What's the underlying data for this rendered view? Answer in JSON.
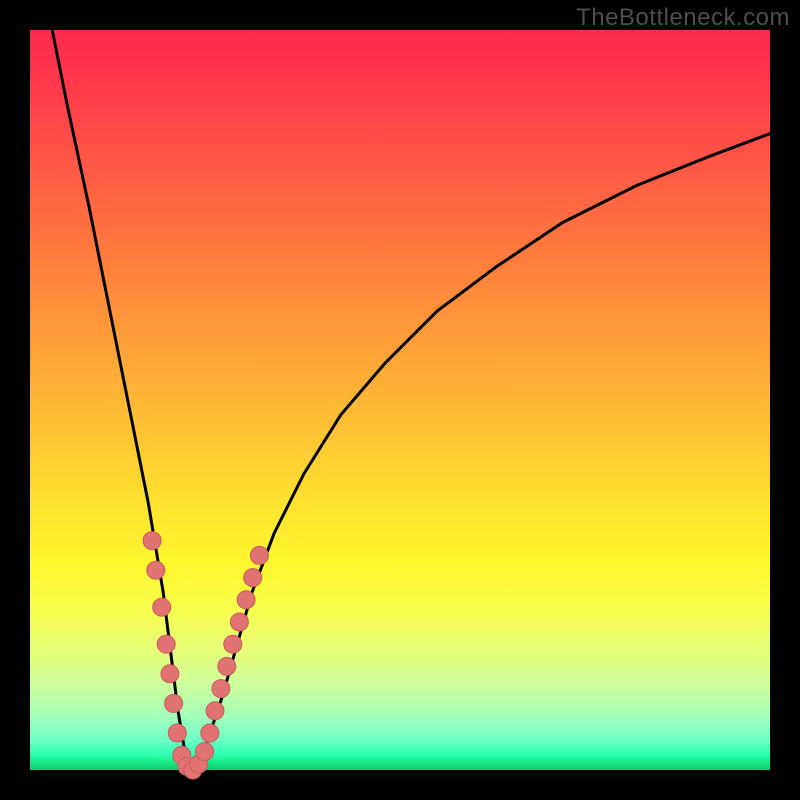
{
  "watermark": "TheBottleneck.com",
  "colors": {
    "frame": "#000000",
    "gradient_top": "#ff2a4d",
    "gradient_bottom": "#14c96b",
    "curve": "#000000",
    "marker_fill": "#e27373",
    "marker_stroke": "#c75a5a"
  },
  "chart_data": {
    "type": "line",
    "title": "",
    "xlabel": "",
    "ylabel": "",
    "xlim": [
      0,
      100
    ],
    "ylim": [
      0,
      100
    ],
    "note": "Axes have no tick labels in the image; x is an implicit horizontal scale 0–100, y is bottleneck percentage where 0 (bottom/green) = no bottleneck and 100 (top/red) = severe. Values are estimated from pixel positions.",
    "series": [
      {
        "name": "bottleneck-curve",
        "x": [
          3,
          5,
          8,
          10,
          12,
          14,
          16,
          18,
          19,
          20,
          21,
          22,
          23,
          24,
          26,
          28,
          30,
          33,
          37,
          42,
          48,
          55,
          63,
          72,
          82,
          92,
          100
        ],
        "y": [
          100,
          90,
          76,
          66,
          56,
          46,
          36,
          24,
          16,
          8,
          2,
          0,
          1,
          4,
          10,
          17,
          24,
          32,
          40,
          48,
          55,
          62,
          68,
          74,
          79,
          83,
          86
        ]
      },
      {
        "name": "highlighted-points",
        "type": "scatter",
        "x": [
          16.5,
          17.0,
          17.8,
          18.4,
          18.9,
          19.4,
          19.9,
          20.5,
          21.2,
          22.0,
          22.8,
          23.6,
          24.3,
          25.0,
          25.8,
          26.6,
          27.4,
          28.3,
          29.2,
          30.1,
          31.0
        ],
        "y": [
          31,
          27,
          22,
          17,
          13,
          9,
          5,
          2,
          0.5,
          0,
          0.8,
          2.5,
          5,
          8,
          11,
          14,
          17,
          20,
          23,
          26,
          29
        ]
      }
    ]
  }
}
